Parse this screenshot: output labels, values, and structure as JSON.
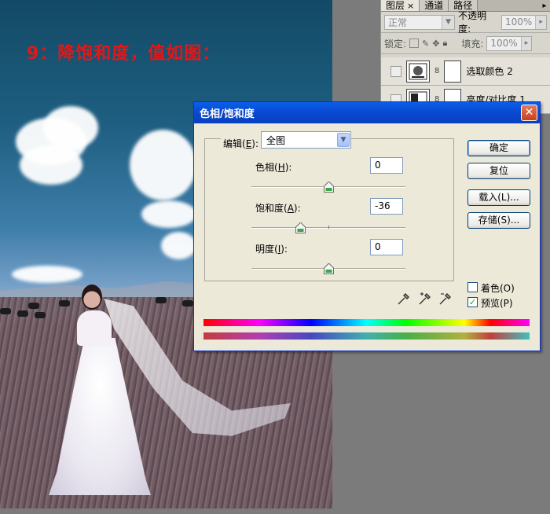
{
  "caption": "9：降饱和度，值如图：",
  "layers_panel": {
    "tabs": [
      "图层",
      "通道",
      "路径"
    ],
    "blend_mode": "正常",
    "opacity_label": "不透明度:",
    "opacity_value": "100%",
    "lock_label": "锁定:",
    "fill_label": "填充:",
    "fill_value": "100%",
    "layers": [
      {
        "name": "选取颜色 2"
      },
      {
        "name": "亮度/对比度 1"
      }
    ]
  },
  "dialog": {
    "title": "色相/饱和度",
    "edit_label": "编辑(",
    "edit_key": "E",
    "edit_suffix": "):",
    "edit_value": "全图",
    "hue_label_pre": "色相(",
    "hue_key": "H",
    "hue_label_post": "):",
    "hue_value": "0",
    "hue_level": 0,
    "saturation_label_pre": "饱和度(",
    "saturation_key": "A",
    "saturation_label_post": "):",
    "saturation_value": "-36",
    "saturation_level": -36,
    "lightness_label_pre": "明度(",
    "lightness_key": "I",
    "lightness_label_post": "):",
    "lightness_value": "0",
    "lightness_level": 0,
    "ok_label": "确定",
    "reset_label": "复位",
    "load_label": "载入(L)...",
    "save_label": "存储(S)...",
    "colorize_label": "着色(O)",
    "colorize_checked": false,
    "preview_label": "预览(P)",
    "preview_checked": true
  }
}
